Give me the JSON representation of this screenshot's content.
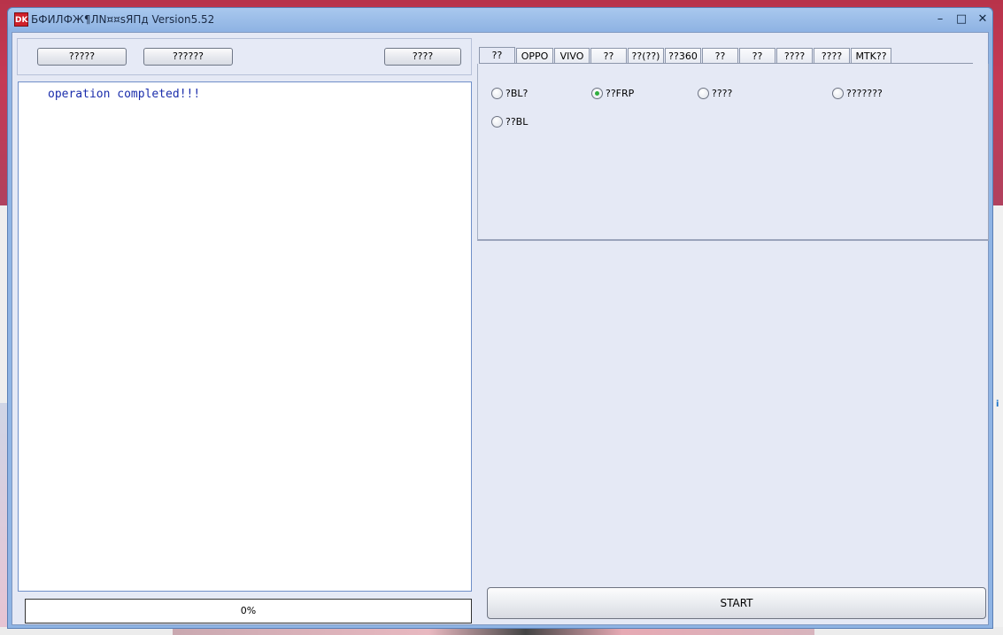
{
  "window": {
    "title": "БФИЛФЖ¶ЛN¤¤sЯПд Version5.52",
    "app_icon_text": "DK",
    "minimize_glyph": "–",
    "maximize_glyph": "□",
    "close_glyph": "✕"
  },
  "toolbar": {
    "btn1_label": "?????",
    "btn2_label": "??????",
    "btn3_label": "????"
  },
  "log": {
    "lines": [
      "operation completed!!!"
    ]
  },
  "progress": {
    "value": 0,
    "text": "0%"
  },
  "tabs": [
    {
      "label": "??"
    },
    {
      "label": "OPPO"
    },
    {
      "label": "VIVO"
    },
    {
      "label": "??"
    },
    {
      "label": "??(??)"
    },
    {
      "label": "??360"
    },
    {
      "label": "??"
    },
    {
      "label": "??"
    },
    {
      "label": "????"
    },
    {
      "label": "????"
    },
    {
      "label": "MTK??"
    }
  ],
  "active_tab_index": 0,
  "options": [
    {
      "label": "?BL?",
      "checked": false
    },
    {
      "label": "??FRP",
      "checked": true
    },
    {
      "label": "????",
      "checked": false
    },
    {
      "label": "???????",
      "checked": false
    },
    {
      "label": "??BL",
      "checked": false
    }
  ],
  "start_label": "START",
  "colors": {
    "accent_check": "#2fae3e",
    "log_text": "#1a2dab",
    "titlebar": "#a9c8ee"
  }
}
